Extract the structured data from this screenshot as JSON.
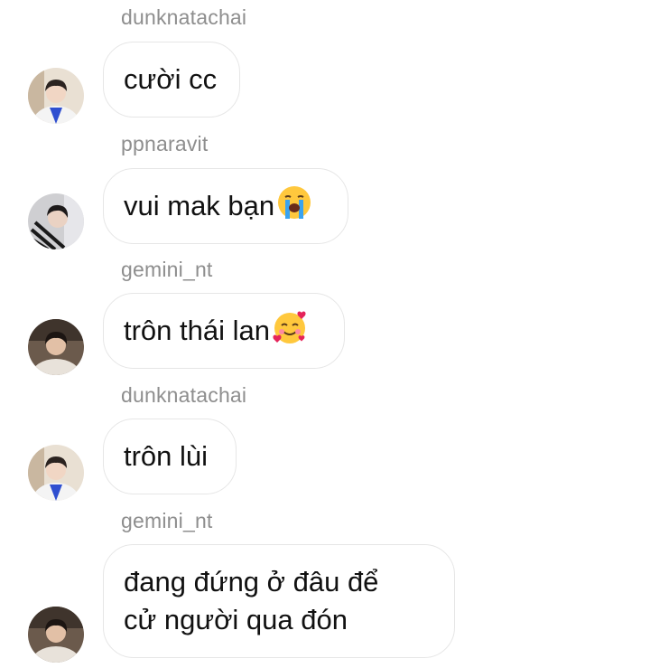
{
  "messages": [
    {
      "sender": "dunknatachai",
      "text": "cười cc",
      "avatar": "avatar-dunk"
    },
    {
      "sender": "ppnaravit",
      "text": "vui mak bạn",
      "emoji": "loudly-crying-face-emoji",
      "avatar": "avatar-ppnaravit"
    },
    {
      "sender": "gemini_nt",
      "text": "trôn thái lan",
      "emoji": "smiling-face-with-hearts-emoji",
      "avatar": "avatar-gemini"
    },
    {
      "sender": "dunknatachai",
      "text": "trôn lùi",
      "avatar": "avatar-dunk"
    },
    {
      "sender": "gemini_nt",
      "lines": [
        "đang đứng ở đâu để",
        "cử người qua đón"
      ],
      "avatar": "avatar-gemini"
    }
  ],
  "colors": {
    "sender_text": "#8e8e8e",
    "bubble_border": "#e6e6e6",
    "message_text": "#111111",
    "background": "#ffffff"
  }
}
